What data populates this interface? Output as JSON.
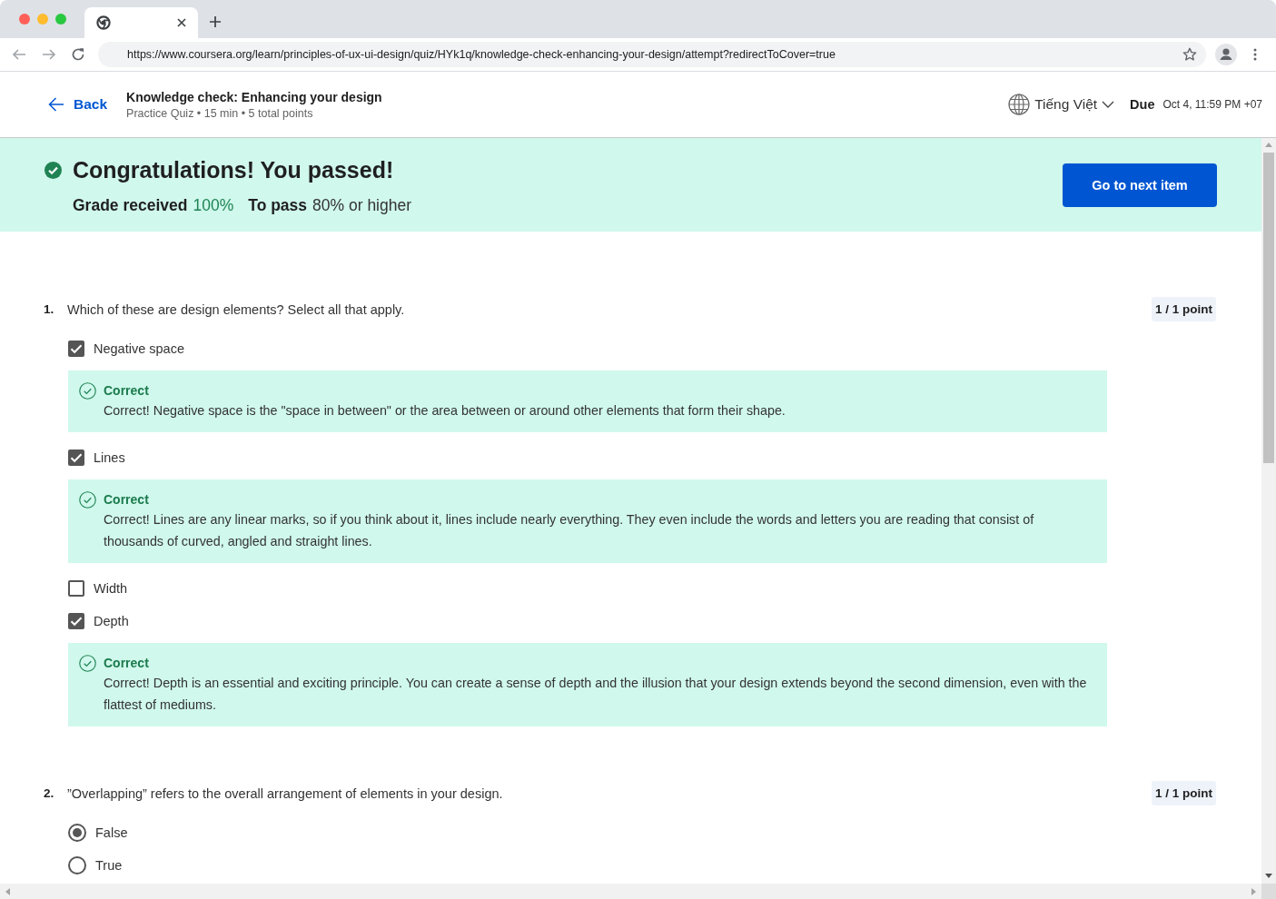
{
  "browser": {
    "url": "https://www.coursera.org/learn/principles-of-ux-ui-design/quiz/HYk1q/knowledge-check-enhancing-your-design/attempt?redirectToCover=true"
  },
  "header": {
    "back": "Back",
    "title": "Knowledge check: Enhancing your design",
    "meta": "Practice Quiz • 15 min • 5 total points",
    "language": "Tiếng Việt",
    "due_label": "Due",
    "due_date": "Oct 4, 11:59 PM +07"
  },
  "banner": {
    "title": "Congratulations! You passed!",
    "grade_label": "Grade received",
    "grade_value": "100%",
    "pass_label": "To pass",
    "pass_value": "80% or higher",
    "button": "Go to next item"
  },
  "questions": [
    {
      "number": "1.",
      "text": "Which of these are design elements? Select all that apply.",
      "points": "1 / 1 point",
      "kind": "checkbox",
      "options": [
        {
          "label": "Negative space",
          "checked": true,
          "feedback": {
            "title": "Correct",
            "text": "Correct! Negative space is the \"space in between\" or the area between or around other elements that form their shape."
          }
        },
        {
          "label": "Lines",
          "checked": true,
          "feedback": {
            "title": "Correct",
            "text": "Correct! Lines are any linear marks, so if you think about it, lines include nearly everything. They even include the words and letters you are reading that consist of thousands of curved, angled and straight lines."
          }
        },
        {
          "label": "Width",
          "checked": false
        },
        {
          "label": "Depth",
          "checked": true,
          "feedback": {
            "title": "Correct",
            "text": "Correct! Depth is an essential and exciting principle. You can create a sense of depth and the illusion that your design extends beyond the second dimension, even with the flattest of mediums."
          }
        }
      ]
    },
    {
      "number": "2.",
      "text": "”Overlapping” refers to the overall arrangement of elements in your design.",
      "points": "1 / 1 point",
      "kind": "radio",
      "options": [
        {
          "label": "False",
          "selected": true
        },
        {
          "label": "True",
          "selected": false
        }
      ]
    }
  ]
}
